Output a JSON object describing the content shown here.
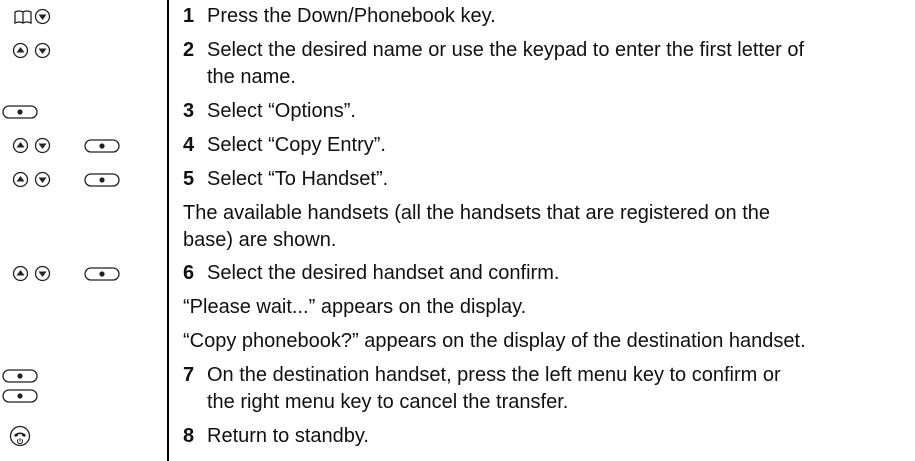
{
  "steps": [
    {
      "num": "1",
      "line1": "Press the Down/Phonebook key.",
      "line2": "",
      "icons": [
        "phonebook-icon",
        "down-key-icon"
      ]
    },
    {
      "num": "2",
      "line1": "Select the desired name or use the keypad to enter the first letter of",
      "line2": "the name.",
      "icons": [
        "up-key-icon",
        "down-key-icon"
      ]
    },
    {
      "num": "3",
      "line1": "Select “Options”.",
      "line2": "",
      "icons": [
        "menu-key-icon"
      ]
    },
    {
      "num": "4",
      "line1": "Select “Copy Entry”.",
      "line2": "",
      "icons": [
        "up-key-icon",
        "down-key-icon",
        "menu-key-icon"
      ]
    },
    {
      "num": "5",
      "line1": "Select “To Handset”.",
      "line2": "",
      "icons": [
        "up-key-icon",
        "down-key-icon",
        "menu-key-icon"
      ]
    },
    {
      "num": "6",
      "line1": "Select the desired handset and confirm.",
      "line2": "",
      "icons": [
        "up-key-icon",
        "down-key-icon",
        "menu-key-icon"
      ]
    },
    {
      "num": "7",
      "line1": "On the destination handset, press the left menu key to confirm or",
      "line2": "the right menu key to cancel the transfer.",
      "icons": [
        "left-menu-key-icon",
        "right-menu-key-icon"
      ]
    },
    {
      "num": "8",
      "line1": "Return to standby.",
      "line2": "",
      "icons": [
        "end-call-key-icon"
      ]
    }
  ],
  "notes": {
    "handsets_shown_line1": "The available handsets (all the handsets that are registered on the",
    "handsets_shown_line2": "base) are shown.",
    "please_wait": "“Please wait...” appears on the display.",
    "copy_phonebook": "“Copy phonebook?” appears on the display of the destination handset."
  }
}
